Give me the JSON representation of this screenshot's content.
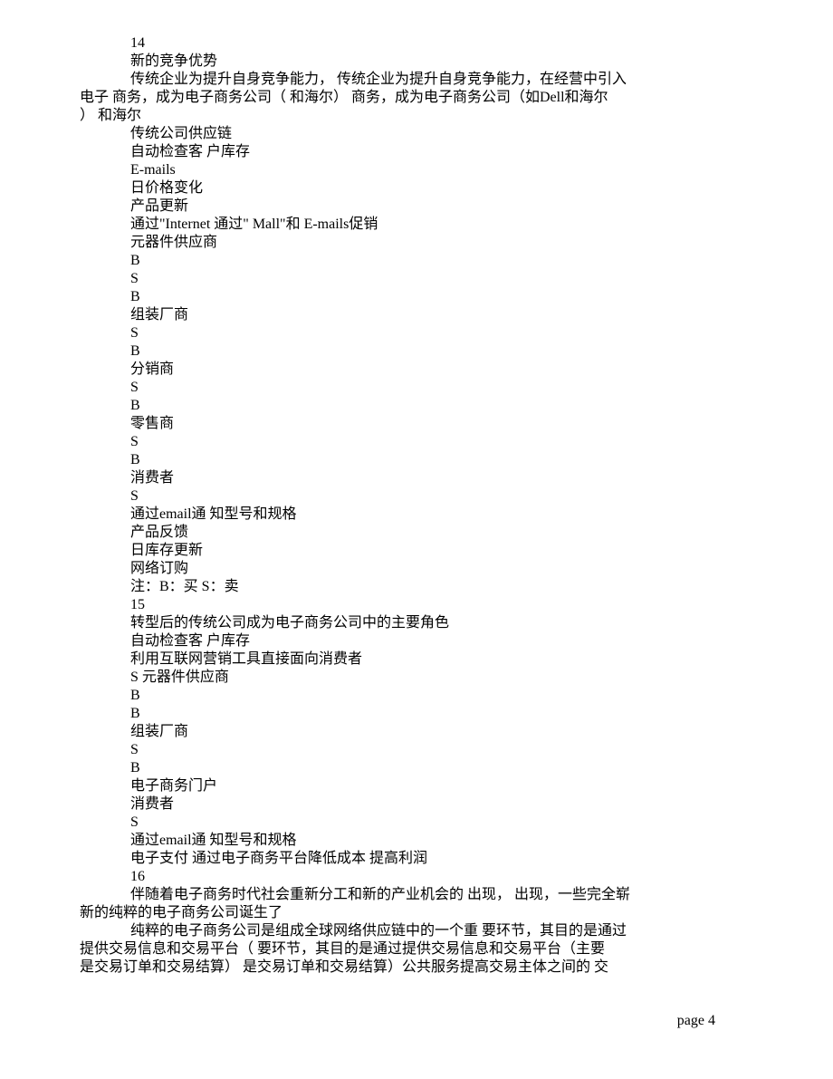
{
  "lines": [
    {
      "text": "14",
      "indent": true
    },
    {
      "text": "新的竞争优势",
      "indent": true
    },
    {
      "text": "传统企业为提升自身竞争能力， 传统企业为提升自身竞争能力，在经营中引入",
      "indent": true
    },
    {
      "text": "电子 商务，成为电子商务公司（ 和海尔） 商务，成为电子商务公司（如Dell和海尔",
      "indent": false
    },
    {
      "text": "） 和海尔",
      "indent": false
    },
    {
      "text": "传统公司供应链",
      "indent": true
    },
    {
      "text": "自动检查客 户库存",
      "indent": true
    },
    {
      "text": "E-mails",
      "indent": true
    },
    {
      "text": "日价格变化",
      "indent": true
    },
    {
      "text": "产品更新",
      "indent": true
    },
    {
      "text": "通过\"Internet 通过\" Mall\"和 E-mails促销",
      "indent": true
    },
    {
      "text": "元器件供应商",
      "indent": true
    },
    {
      "text": "B",
      "indent": true
    },
    {
      "text": "S",
      "indent": true
    },
    {
      "text": "B",
      "indent": true
    },
    {
      "text": "组装厂商",
      "indent": true
    },
    {
      "text": "S",
      "indent": true
    },
    {
      "text": "B",
      "indent": true
    },
    {
      "text": "分销商",
      "indent": true
    },
    {
      "text": "S",
      "indent": true
    },
    {
      "text": "B",
      "indent": true
    },
    {
      "text": "零售商",
      "indent": true
    },
    {
      "text": "S",
      "indent": true
    },
    {
      "text": "B",
      "indent": true
    },
    {
      "text": "消费者",
      "indent": true
    },
    {
      "text": "S",
      "indent": true
    },
    {
      "text": "通过email通 知型号和规格",
      "indent": true
    },
    {
      "text": "产品反馈",
      "indent": true
    },
    {
      "text": "日库存更新",
      "indent": true
    },
    {
      "text": "网络订购",
      "indent": true
    },
    {
      "text": "注：B：买 S：卖",
      "indent": true
    },
    {
      "text": "15",
      "indent": true
    },
    {
      "text": "转型后的传统公司成为电子商务公司中的主要角色",
      "indent": true
    },
    {
      "text": "自动检查客 户库存",
      "indent": true
    },
    {
      "text": "利用互联网营销工具直接面向消费者",
      "indent": true
    },
    {
      "text": "S 元器件供应商",
      "indent": true
    },
    {
      "text": "B",
      "indent": true
    },
    {
      "text": "B",
      "indent": true
    },
    {
      "text": "组装厂商",
      "indent": true
    },
    {
      "text": "S",
      "indent": true
    },
    {
      "text": "B",
      "indent": true
    },
    {
      "text": "电子商务门户",
      "indent": true
    },
    {
      "text": "消费者",
      "indent": true
    },
    {
      "text": "S",
      "indent": true
    },
    {
      "text": "通过email通 知型号和规格",
      "indent": true
    },
    {
      "text": "电子支付 通过电子商务平台降低成本 提高利润",
      "indent": true
    },
    {
      "text": "16",
      "indent": true
    },
    {
      "text": "伴随着电子商务时代社会重新分工和新的产业机会的 出现， 出现，一些完全崭",
      "indent": true
    },
    {
      "text": "新的纯粹的电子商务公司诞生了",
      "indent": false
    },
    {
      "text": "纯粹的电子商务公司是组成全球网络供应链中的一个重 要环节，其目的是通过",
      "indent": true
    },
    {
      "text": "提供交易信息和交易平台（ 要环节，其目的是通过提供交易信息和交易平台（主要",
      "indent": false
    },
    {
      "text": "是交易订单和交易结算） 是交易订单和交易结算）公共服务提高交易主体之间的 交",
      "indent": false
    }
  ],
  "footer": "page 4"
}
